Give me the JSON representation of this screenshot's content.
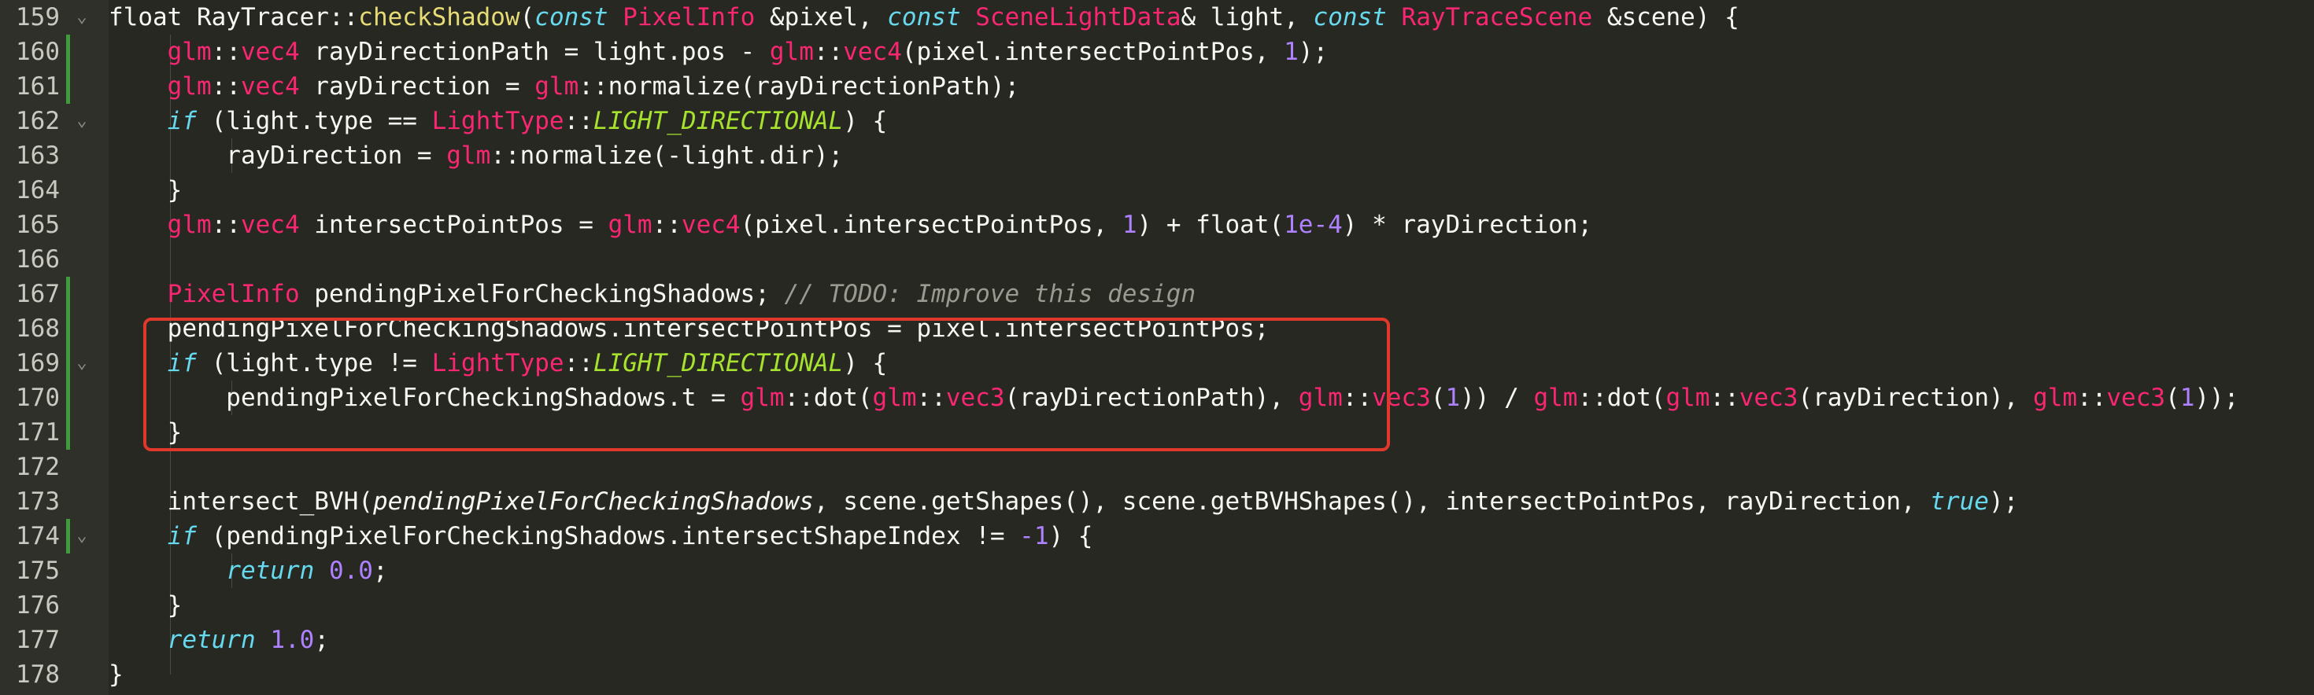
{
  "colors": {
    "background": "#272822",
    "gutter": "#2f302a",
    "modified_bar": "#3f9b3c",
    "highlight_box": "#e0392b",
    "type": "#f92672",
    "function": "#e6db74",
    "number": "#ae81ff",
    "keyword": "#66d9ef",
    "enum": "#a6e22e",
    "comment": "#9a9a90",
    "text": "#f8f8f2"
  },
  "icons": {
    "fold": "chevron-down-icon"
  },
  "lines": [
    {
      "number": "159",
      "fold": true,
      "modified": false,
      "tokens": [
        {
          "t": "float ",
          "c": "plain"
        },
        {
          "t": "RayTracer",
          "c": "plain"
        },
        {
          "t": "::",
          "c": "plain"
        },
        {
          "t": "checkShadow",
          "c": "func"
        },
        {
          "t": "(",
          "c": "plain"
        },
        {
          "t": "const",
          "c": "kw"
        },
        {
          "t": " ",
          "c": "plain"
        },
        {
          "t": "PixelInfo",
          "c": "type"
        },
        {
          "t": " &pixel, ",
          "c": "plain"
        },
        {
          "t": "const",
          "c": "kw"
        },
        {
          "t": " ",
          "c": "plain"
        },
        {
          "t": "SceneLightData",
          "c": "type"
        },
        {
          "t": "& light, ",
          "c": "plain"
        },
        {
          "t": "const",
          "c": "kw"
        },
        {
          "t": " ",
          "c": "plain"
        },
        {
          "t": "RayTraceScene",
          "c": "type"
        },
        {
          "t": " &scene) {",
          "c": "plain"
        }
      ]
    },
    {
      "number": "160",
      "fold": false,
      "modified": true,
      "tokens": [
        {
          "t": "    ",
          "c": "plain"
        },
        {
          "t": "glm",
          "c": "type"
        },
        {
          "t": "::",
          "c": "plain"
        },
        {
          "t": "vec4",
          "c": "type"
        },
        {
          "t": " rayDirectionPath = light.pos - ",
          "c": "plain"
        },
        {
          "t": "glm",
          "c": "type"
        },
        {
          "t": "::",
          "c": "plain"
        },
        {
          "t": "vec4",
          "c": "type"
        },
        {
          "t": "(pixel.intersectPointPos, ",
          "c": "plain"
        },
        {
          "t": "1",
          "c": "num"
        },
        {
          "t": ");",
          "c": "plain"
        }
      ]
    },
    {
      "number": "161",
      "fold": false,
      "modified": true,
      "tokens": [
        {
          "t": "    ",
          "c": "plain"
        },
        {
          "t": "glm",
          "c": "type"
        },
        {
          "t": "::",
          "c": "plain"
        },
        {
          "t": "vec4",
          "c": "type"
        },
        {
          "t": " rayDirection = ",
          "c": "plain"
        },
        {
          "t": "glm",
          "c": "type"
        },
        {
          "t": "::normalize(rayDirectionPath);",
          "c": "plain"
        }
      ]
    },
    {
      "number": "162",
      "fold": true,
      "modified": false,
      "tokens": [
        {
          "t": "    ",
          "c": "plain"
        },
        {
          "t": "if",
          "c": "kw"
        },
        {
          "t": " (light.type == ",
          "c": "plain"
        },
        {
          "t": "LightType",
          "c": "type"
        },
        {
          "t": "::",
          "c": "plain"
        },
        {
          "t": "LIGHT_DIRECTIONAL",
          "c": "enum"
        },
        {
          "t": ") {",
          "c": "plain"
        }
      ]
    },
    {
      "number": "163",
      "fold": false,
      "modified": false,
      "tokens": [
        {
          "t": "        rayDirection = ",
          "c": "plain"
        },
        {
          "t": "glm",
          "c": "type"
        },
        {
          "t": "::normalize(-light.dir);",
          "c": "plain"
        }
      ]
    },
    {
      "number": "164",
      "fold": false,
      "modified": false,
      "tokens": [
        {
          "t": "    }",
          "c": "plain"
        }
      ]
    },
    {
      "number": "165",
      "fold": false,
      "modified": false,
      "tokens": [
        {
          "t": "    ",
          "c": "plain"
        },
        {
          "t": "glm",
          "c": "type"
        },
        {
          "t": "::",
          "c": "plain"
        },
        {
          "t": "vec4",
          "c": "type"
        },
        {
          "t": " intersectPointPos = ",
          "c": "plain"
        },
        {
          "t": "glm",
          "c": "type"
        },
        {
          "t": "::",
          "c": "plain"
        },
        {
          "t": "vec4",
          "c": "type"
        },
        {
          "t": "(pixel.intersectPointPos, ",
          "c": "plain"
        },
        {
          "t": "1",
          "c": "num"
        },
        {
          "t": ") + float(",
          "c": "plain"
        },
        {
          "t": "1e-4",
          "c": "num"
        },
        {
          "t": ") * rayDirection;",
          "c": "plain"
        }
      ]
    },
    {
      "number": "166",
      "fold": false,
      "modified": false,
      "tokens": []
    },
    {
      "number": "167",
      "fold": false,
      "modified": true,
      "tokens": [
        {
          "t": "    ",
          "c": "plain"
        },
        {
          "t": "PixelInfo",
          "c": "type"
        },
        {
          "t": " pendingPixelForCheckingShadows; ",
          "c": "plain"
        },
        {
          "t": "// TODO: Improve this design",
          "c": "comment"
        }
      ]
    },
    {
      "number": "168",
      "fold": false,
      "modified": true,
      "tokens": [
        {
          "t": "    pendingPixelForCheckingShadows.intersectPointPos = pixel.intersectPointPos;",
          "c": "plain"
        }
      ]
    },
    {
      "number": "169",
      "fold": true,
      "modified": true,
      "tokens": [
        {
          "t": "    ",
          "c": "plain"
        },
        {
          "t": "if",
          "c": "kw"
        },
        {
          "t": " (light.type != ",
          "c": "plain"
        },
        {
          "t": "LightType",
          "c": "type"
        },
        {
          "t": "::",
          "c": "plain"
        },
        {
          "t": "LIGHT_DIRECTIONAL",
          "c": "enum"
        },
        {
          "t": ") {",
          "c": "plain"
        }
      ]
    },
    {
      "number": "170",
      "fold": false,
      "modified": true,
      "tokens": [
        {
          "t": "        pendingPixelForCheckingShadows.t = ",
          "c": "plain"
        },
        {
          "t": "glm",
          "c": "type"
        },
        {
          "t": "::dot(",
          "c": "plain"
        },
        {
          "t": "glm",
          "c": "type"
        },
        {
          "t": "::",
          "c": "plain"
        },
        {
          "t": "vec3",
          "c": "type"
        },
        {
          "t": "(rayDirectionPath), ",
          "c": "plain"
        },
        {
          "t": "glm",
          "c": "type"
        },
        {
          "t": "::",
          "c": "plain"
        },
        {
          "t": "vec3",
          "c": "type"
        },
        {
          "t": "(",
          "c": "plain"
        },
        {
          "t": "1",
          "c": "num"
        },
        {
          "t": ")) / ",
          "c": "plain"
        },
        {
          "t": "glm",
          "c": "type"
        },
        {
          "t": "::dot(",
          "c": "plain"
        },
        {
          "t": "glm",
          "c": "type"
        },
        {
          "t": "::",
          "c": "plain"
        },
        {
          "t": "vec3",
          "c": "type"
        },
        {
          "t": "(rayDirection), ",
          "c": "plain"
        },
        {
          "t": "glm",
          "c": "type"
        },
        {
          "t": "::",
          "c": "plain"
        },
        {
          "t": "vec3",
          "c": "type"
        },
        {
          "t": "(",
          "c": "plain"
        },
        {
          "t": "1",
          "c": "num"
        },
        {
          "t": "));",
          "c": "plain"
        }
      ]
    },
    {
      "number": "171",
      "fold": false,
      "modified": true,
      "tokens": [
        {
          "t": "    }",
          "c": "plain"
        }
      ]
    },
    {
      "number": "172",
      "fold": false,
      "modified": false,
      "tokens": []
    },
    {
      "number": "173",
      "fold": false,
      "modified": false,
      "tokens": [
        {
          "t": "    intersect_BVH(",
          "c": "plain"
        },
        {
          "t": "pendingPixelForCheckingShadows",
          "c": "italic"
        },
        {
          "t": ", scene.getShapes(), scene.getBVHShapes(), intersectPointPos, rayDirection, ",
          "c": "plain"
        },
        {
          "t": "true",
          "c": "kw"
        },
        {
          "t": ");",
          "c": "plain"
        }
      ]
    },
    {
      "number": "174",
      "fold": true,
      "modified": true,
      "tokens": [
        {
          "t": "    ",
          "c": "plain"
        },
        {
          "t": "if",
          "c": "kw"
        },
        {
          "t": " (pendingPixelForCheckingShadows.intersectShapeIndex != ",
          "c": "plain"
        },
        {
          "t": "-1",
          "c": "num"
        },
        {
          "t": ") {",
          "c": "plain"
        }
      ]
    },
    {
      "number": "175",
      "fold": false,
      "modified": false,
      "tokens": [
        {
          "t": "        ",
          "c": "plain"
        },
        {
          "t": "return",
          "c": "kw"
        },
        {
          "t": " ",
          "c": "plain"
        },
        {
          "t": "0.0",
          "c": "num"
        },
        {
          "t": ";",
          "c": "plain"
        }
      ]
    },
    {
      "number": "176",
      "fold": false,
      "modified": false,
      "tokens": [
        {
          "t": "    }",
          "c": "plain"
        }
      ]
    },
    {
      "number": "177",
      "fold": false,
      "modified": false,
      "tokens": [
        {
          "t": "    ",
          "c": "plain"
        },
        {
          "t": "return",
          "c": "kw"
        },
        {
          "t": " ",
          "c": "plain"
        },
        {
          "t": "1.0",
          "c": "num"
        },
        {
          "t": ";",
          "c": "plain"
        }
      ]
    },
    {
      "number": "178",
      "fold": false,
      "modified": false,
      "tokens": [
        {
          "t": "}",
          "c": "plain"
        }
      ]
    }
  ]
}
